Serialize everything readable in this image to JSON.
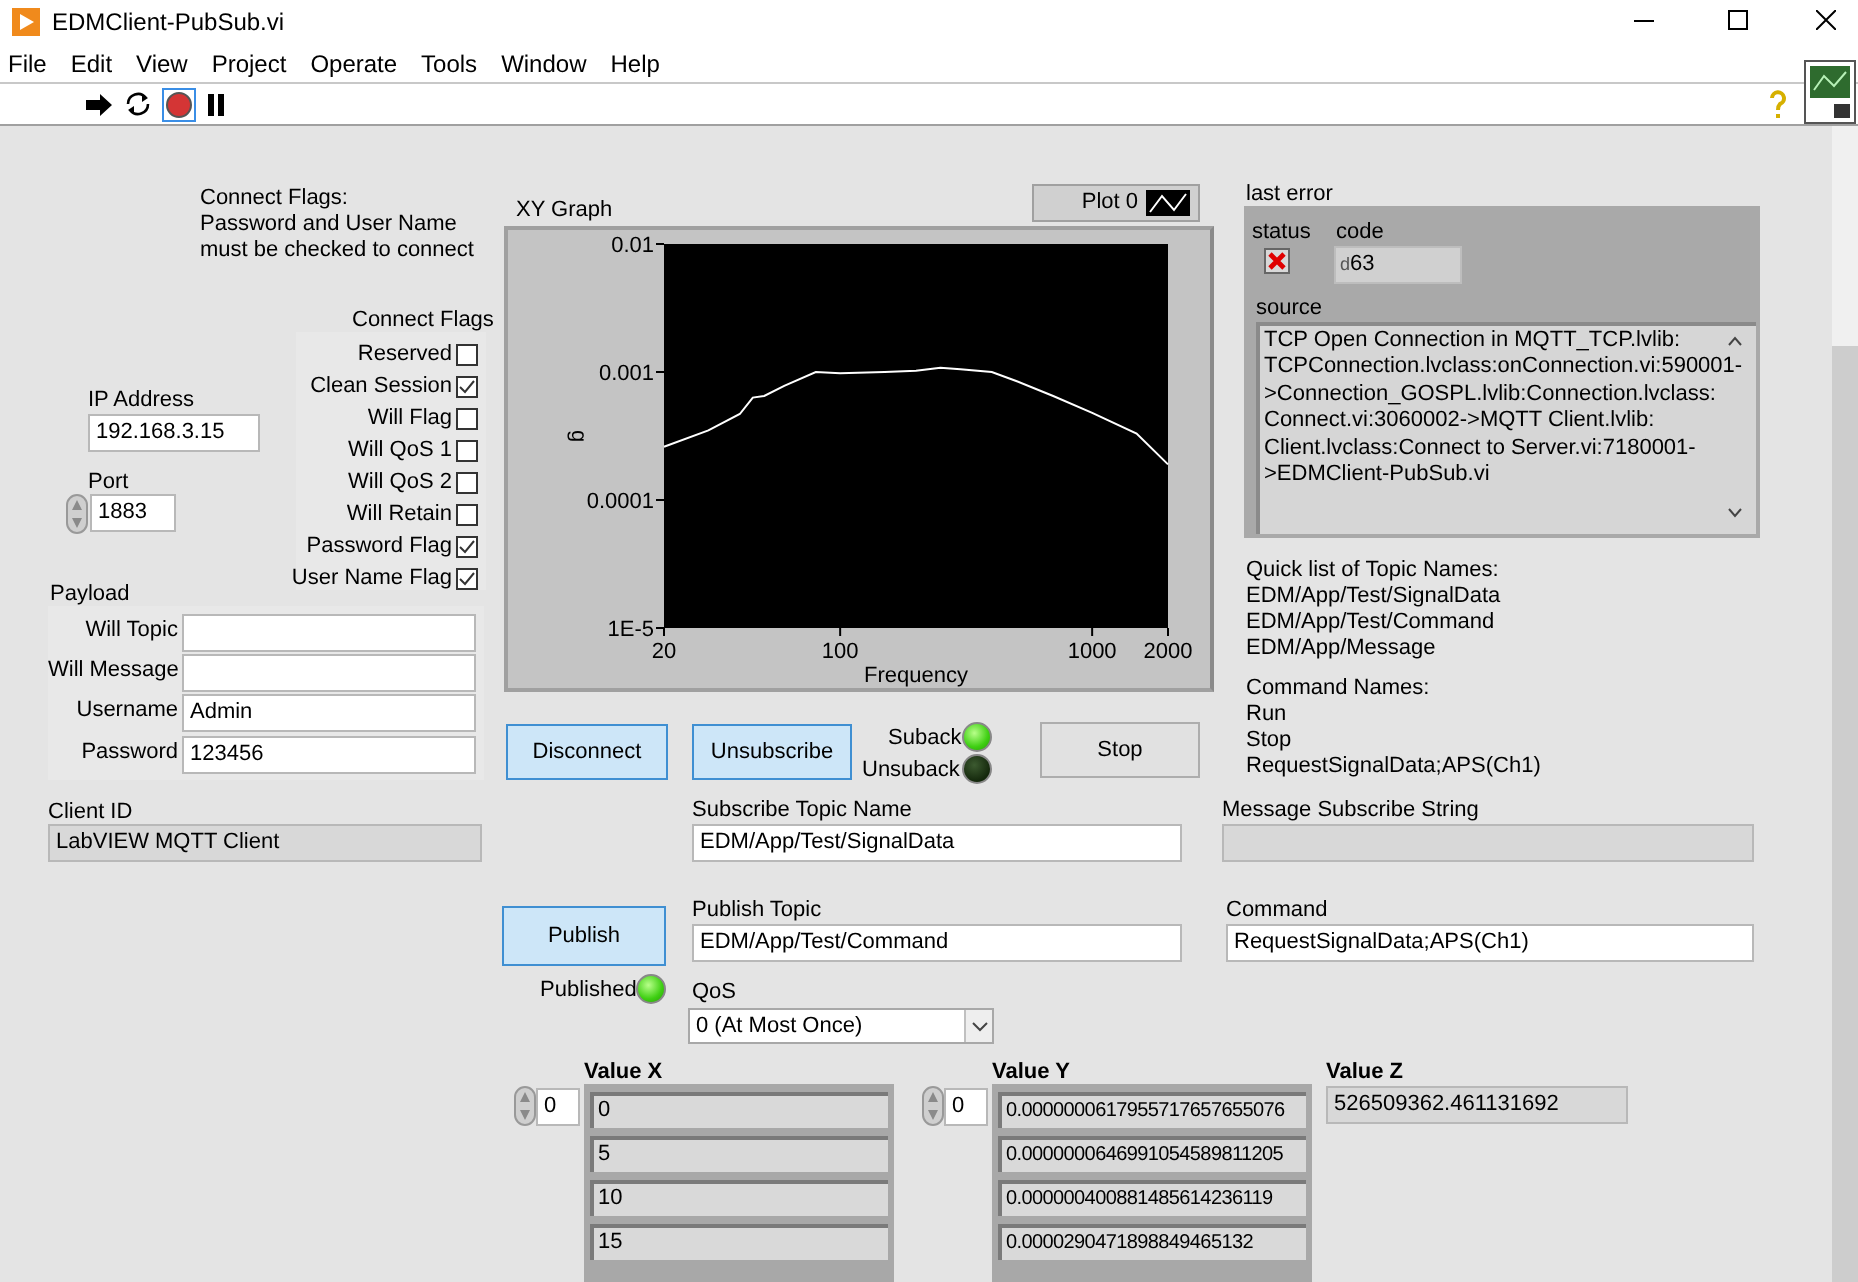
{
  "window": {
    "title": "EDMClient-PubSub.vi"
  },
  "menu": [
    "File",
    "Edit",
    "View",
    "Project",
    "Operate",
    "Tools",
    "Window",
    "Help"
  ],
  "note": "Connect Flags:\nPassword and User Name must be checked to connect",
  "connect_flags": {
    "label": "Connect Flags",
    "items": [
      {
        "label": "Reserved",
        "checked": false
      },
      {
        "label": "Clean Session",
        "checked": true
      },
      {
        "label": "Will Flag",
        "checked": false
      },
      {
        "label": "Will QoS 1",
        "checked": false
      },
      {
        "label": "Will QoS 2",
        "checked": false
      },
      {
        "label": "Will Retain",
        "checked": false
      },
      {
        "label": "Password Flag",
        "checked": true
      },
      {
        "label": "User Name Flag",
        "checked": true
      }
    ]
  },
  "ip_address": {
    "label": "IP Address",
    "value": "192.168.3.15"
  },
  "port": {
    "label": "Port",
    "value": "1883"
  },
  "payload": {
    "label": "Payload",
    "fields": [
      {
        "label": "Will Topic"
      },
      {
        "label": "Will Message"
      },
      {
        "label": "Username",
        "value": "Admin"
      },
      {
        "label": "Password",
        "value": "123456"
      }
    ]
  },
  "client_id": {
    "label": "Client ID",
    "value": "LabVIEW MQTT Client"
  },
  "xy_graph": {
    "label": "XY Graph",
    "legend": "Plot 0",
    "x_axis_label": "Frequency",
    "y_axis_label": "g",
    "x_tick_labels": [
      "20",
      "100",
      "1000",
      "2000"
    ],
    "y_tick_labels": [
      "0.01",
      "0.001",
      "0.0001",
      "1E-5"
    ]
  },
  "last_error": {
    "label": "last error",
    "status_label": "status",
    "status": true,
    "code_label": "code",
    "radix": "d",
    "code": "63",
    "source_label": "source",
    "source": "TCP Open Connection in MQTT_TCP.lvlib: TCPConnection.lvclass:onConnection.vi:590001->Connection_GOSPL.lvlib:Connection.lvclass: Connect.vi:3060002->MQTT Client.lvlib: Client.lvclass:Connect to Server.vi:7180001->EDMClient-PubSub.vi"
  },
  "topic_names": [
    "Quick list of Topic Names:",
    "EDM/App/Test/SignalData",
    "EDM/App/Test/Command",
    "EDM/App/Message"
  ],
  "command_names": [
    "Command Names:",
    "Run",
    "Stop",
    "RequestSignalData;APS(Ch1)"
  ],
  "buttons": [
    {
      "label": "Disconnect",
      "highlighted": true
    },
    {
      "label": "Unsubscribe",
      "highlighted": true
    },
    {
      "label": "Stop",
      "highlighted": false
    },
    {
      "label": "Publish",
      "highlighted": true
    }
  ],
  "leds": [
    {
      "label": "Suback",
      "on": true
    },
    {
      "label": "Unsuback",
      "on": false
    },
    {
      "label": "Published",
      "on": true
    }
  ],
  "subscribe_topic": {
    "label": "Subscribe Topic Name",
    "value": "EDM/App/Test/SignalData"
  },
  "message_subscribe": {
    "label": "Message Subscribe String"
  },
  "publish_topic": {
    "label": "Publish Topic",
    "value": "EDM/App/Test/Command"
  },
  "command": {
    "label": "Command",
    "value": "RequestSignalData;APS(Ch1)"
  },
  "qos": {
    "label": "QoS",
    "value": "0 (At Most Once)"
  },
  "value_x": {
    "label": "Value X",
    "index": "0",
    "items": [
      "0",
      "5",
      "10",
      "15"
    ]
  },
  "value_y": {
    "label": "Value Y",
    "index": "0",
    "items": [
      "0.0000000617955717657655076",
      "0.0000000646991054589811205",
      "0.000000400881485614236119",
      "0.0000290471898849465132"
    ]
  },
  "value_z": {
    "label": "Value Z",
    "value": "526509362.461131692"
  }
}
